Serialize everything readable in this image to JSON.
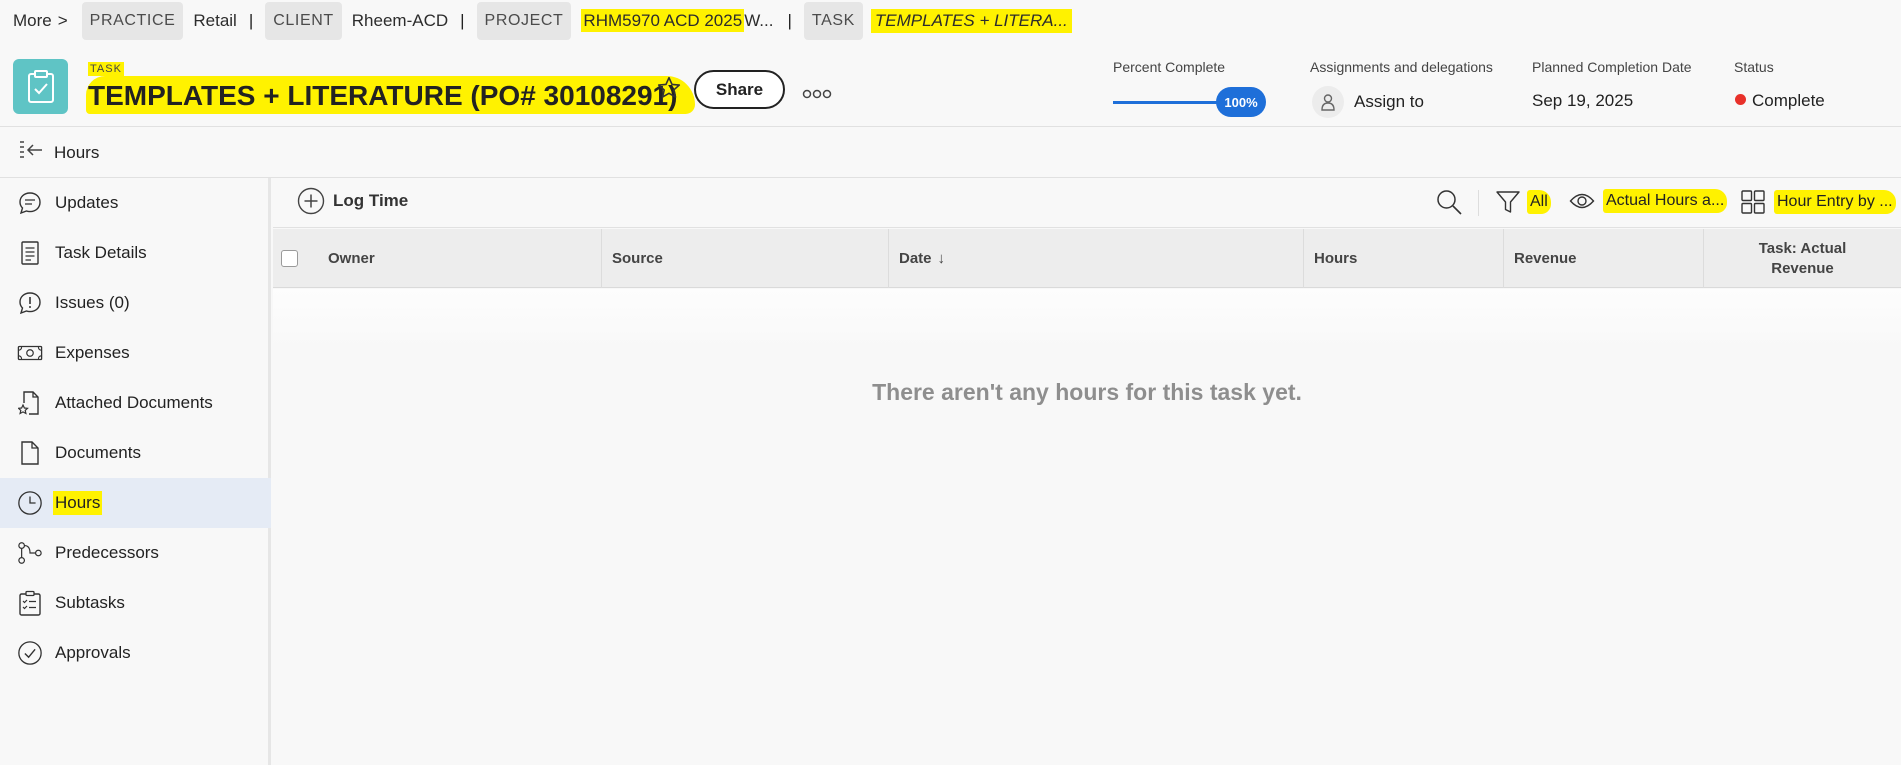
{
  "breadcrumb": {
    "more": "More",
    "more_sep": ">",
    "practice_tag": "PRACTICE",
    "practice_value": "Retail",
    "client_tag": "CLIENT",
    "client_value": "Rheem-ACD",
    "project_tag": "PROJECT",
    "project_value_highlighted": "RHM5970 ACD 2025",
    "project_value_rest": "W...",
    "task_tag": "TASK",
    "task_value": "TEMPLATES + LITERA...",
    "separator": "|"
  },
  "header": {
    "type_label": "TASK",
    "title": "TEMPLATES + LITERATURE (PO# 30108291)",
    "share_label": "Share",
    "icon": "clipboard-check-icon",
    "icon_color": "#5fc4c5",
    "percent_complete_label": "Percent Complete",
    "percent_complete": 100,
    "percent_complete_text": "100%",
    "assignments_label": "Assignments and delegations",
    "assign_value": "Assign to",
    "planned_completion_label": "Planned Completion Date",
    "planned_completion_value": "Sep 19, 2025",
    "status_label": "Status",
    "status_value": "Complete",
    "status_color": "#e8312a",
    "accent_color": "#1e6fd9"
  },
  "back_row": {
    "label": "Hours"
  },
  "sidebar": {
    "items": [
      {
        "label": "Updates",
        "icon": "speech-bubble-icon"
      },
      {
        "label": "Task Details",
        "icon": "document-lines-icon"
      },
      {
        "label": "Issues (0)",
        "icon": "issue-bubble-icon"
      },
      {
        "label": "Expenses",
        "icon": "money-icon"
      },
      {
        "label": "Attached Documents",
        "icon": "starred-document-icon"
      },
      {
        "label": "Documents",
        "icon": "document-icon"
      },
      {
        "label": "Hours",
        "icon": "clock-icon",
        "active": true
      },
      {
        "label": "Predecessors",
        "icon": "predecessors-icon"
      },
      {
        "label": "Subtasks",
        "icon": "checklist-icon"
      },
      {
        "label": "Approvals",
        "icon": "check-circle-icon"
      }
    ]
  },
  "toolbar": {
    "log_time_label": "Log Time",
    "filter_label": "All",
    "view_label": "Actual Hours a...",
    "grouping_label": "Hour Entry by ..."
  },
  "table": {
    "columns": [
      "Owner",
      "Source",
      "Date",
      "Hours",
      "Revenue",
      "Task: Actual Revenue"
    ],
    "sort_indicator": "↓",
    "empty_message": "There aren't any hours for this task yet."
  }
}
